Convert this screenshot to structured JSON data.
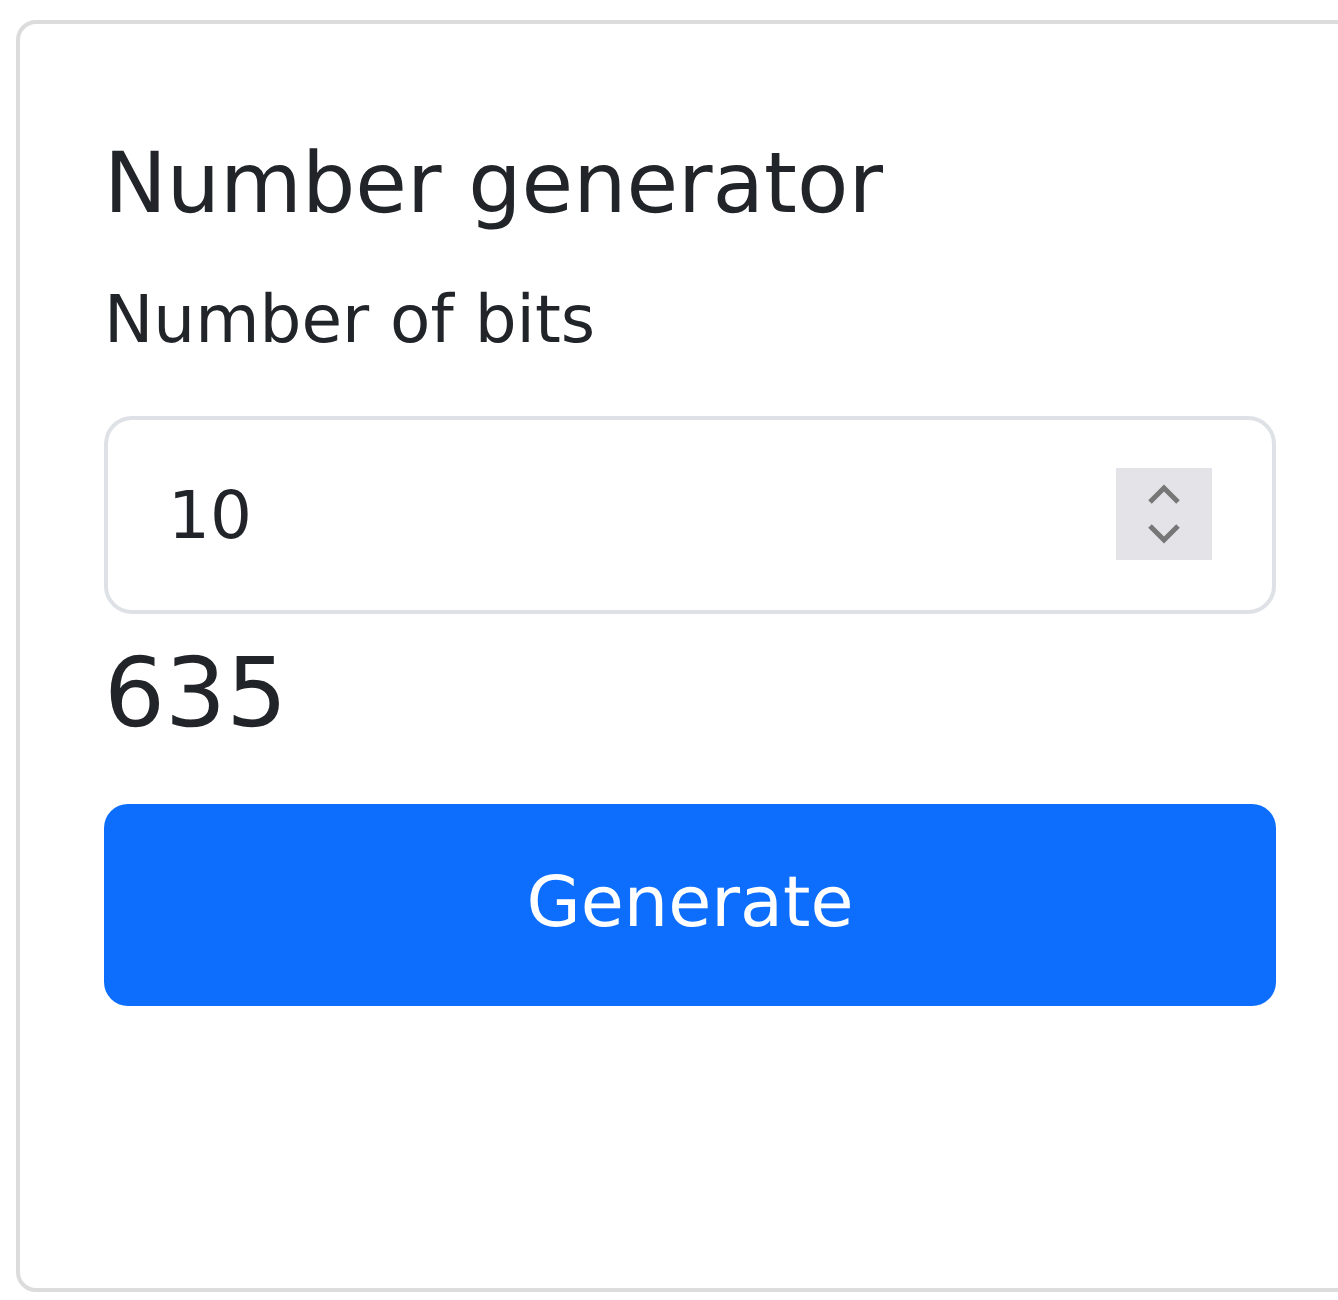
{
  "card": {
    "title": "Number generator",
    "field_label": "Number of bits",
    "field_value": "10",
    "result": "635",
    "button": "Generate"
  }
}
